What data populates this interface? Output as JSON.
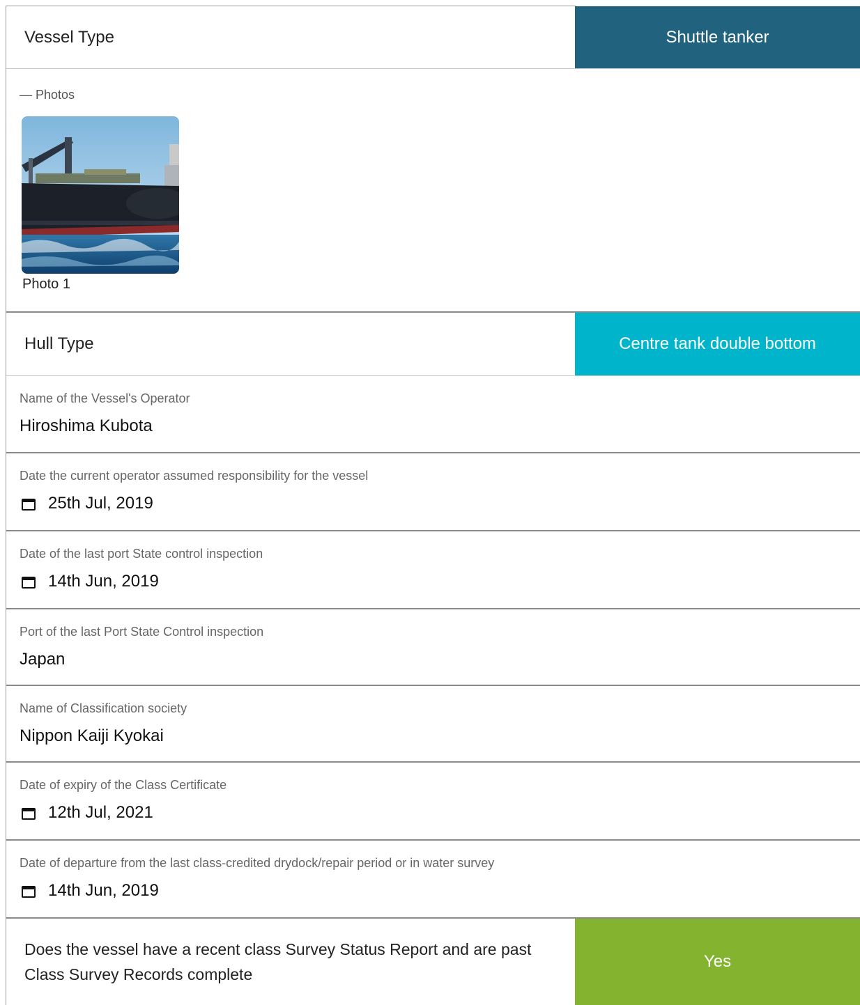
{
  "vessel_type": {
    "label": "Vessel Type",
    "value": "Shuttle tanker",
    "color": "#21637f"
  },
  "photos": {
    "header": "— Photos",
    "items": [
      {
        "caption": "Photo 1"
      }
    ]
  },
  "hull_type": {
    "label": "Hull Type",
    "value": "Centre tank double bottom",
    "color": "#00b5cb"
  },
  "fields": [
    {
      "label": "Name of the Vessel's Operator",
      "value": "Hiroshima Kubota",
      "icon": ""
    },
    {
      "label": "Date the current operator assumed responsibility for the vessel",
      "value": "25th Jul, 2019",
      "icon": "calendar-icon"
    },
    {
      "label": "Date of the last port State control inspection",
      "value": "14th Jun, 2019",
      "icon": "calendar-icon"
    },
    {
      "label": "Port of the last Port State Control inspection",
      "value": "Japan",
      "icon": ""
    },
    {
      "label": "Name of Classification society",
      "value": "Nippon Kaiji Kyokai",
      "icon": ""
    },
    {
      "label": "Date of expiry of the Class Certificate",
      "value": "12th Jul, 2021",
      "icon": "calendar-icon"
    },
    {
      "label": "Date of departure from the last class-credited drydock/repair period or in water survey",
      "value": "14th Jun, 2019",
      "icon": "calendar-icon"
    }
  ],
  "survey": {
    "label": "Does the vessel have a recent class Survey Status Report and are past Class Survey Records complete",
    "value": "Yes",
    "color": "#84b42f"
  }
}
